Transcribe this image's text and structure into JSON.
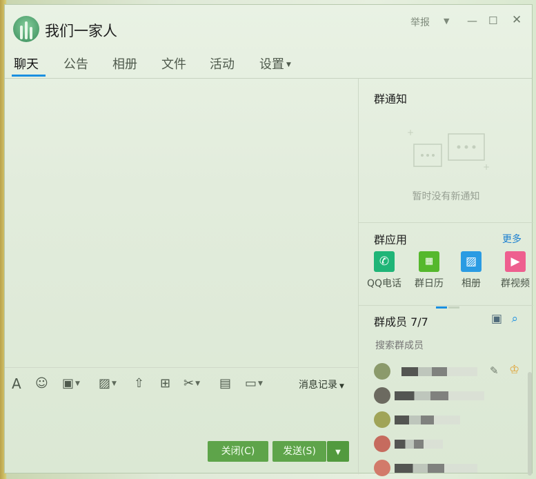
{
  "window": {
    "group_name": "我们一家人",
    "report_label": "举报",
    "minimize_glyph": "—",
    "maximize_glyph": "☐",
    "close_glyph": "✕"
  },
  "tabs": [
    {
      "label": "聊天",
      "active": true
    },
    {
      "label": "公告",
      "active": false
    },
    {
      "label": "相册",
      "active": false
    },
    {
      "label": "文件",
      "active": false
    },
    {
      "label": "活动",
      "active": false
    },
    {
      "label": "设置",
      "active": false
    }
  ],
  "toolbar": {
    "icons": [
      "font-icon",
      "emoji-icon",
      "gif-icon",
      "image-icon",
      "upload-icon",
      "gift-icon",
      "scissors-icon",
      "archive-icon",
      "chat-record-icon"
    ],
    "history_label": "消息记录"
  },
  "buttons": {
    "close_label": "关闭(C)",
    "send_label": "发送(S)"
  },
  "side": {
    "notice_title": "群通知",
    "notice_empty": "暂时没有新通知",
    "apps_title": "群应用",
    "more_label": "更多",
    "apps": [
      {
        "label": "QQ电话",
        "color": "#1fb577",
        "icon": "phone-icon"
      },
      {
        "label": "群日历",
        "color": "#55b82d",
        "icon": "calendar-icon"
      },
      {
        "label": "相册",
        "color": "#2a9be3",
        "icon": "album-icon"
      },
      {
        "label": "群视频",
        "color": "#ee5f8f",
        "icon": "video-icon"
      }
    ],
    "members_title": "群成员 7/7",
    "member_search_placeholder": "搜索群成员",
    "members_count_visible": 5
  },
  "colors": {
    "accent": "#1a8fe0",
    "button_green": "#5ea44a"
  }
}
